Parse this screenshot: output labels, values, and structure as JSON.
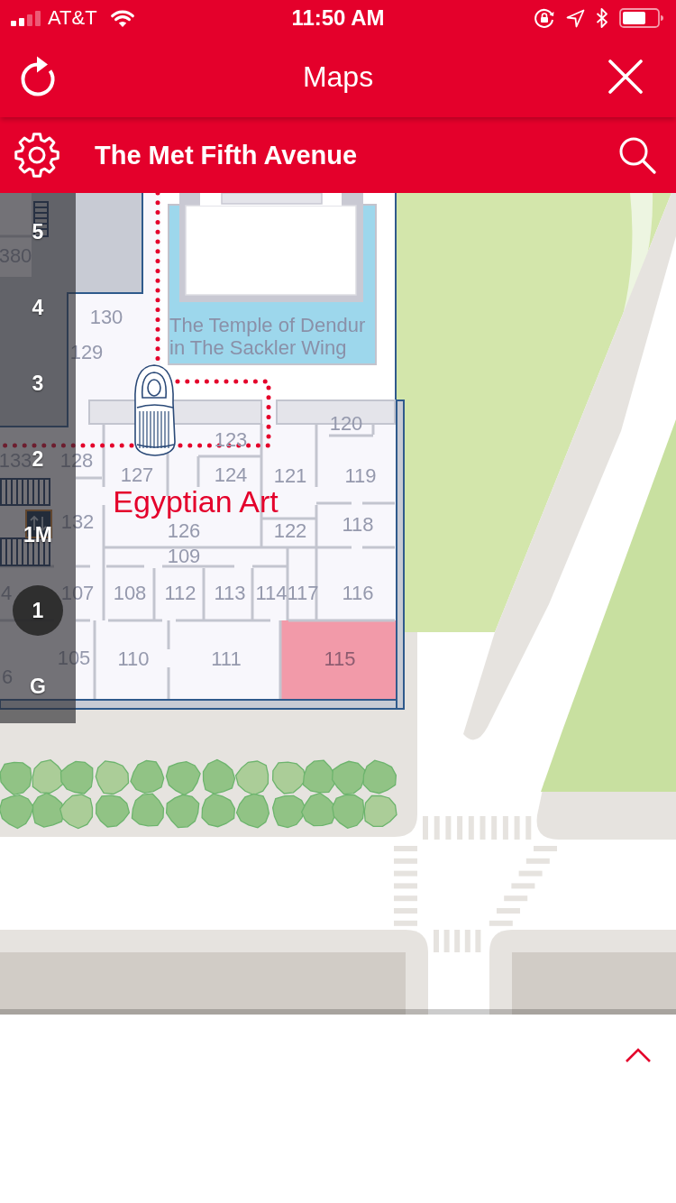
{
  "status_bar": {
    "carrier": "AT&T",
    "time": "11:50 AM"
  },
  "nav_bar": {
    "title": "Maps"
  },
  "location_bar": {
    "title": "The Met Fifth Avenue"
  },
  "map": {
    "landmark_label": "The Temple of Dendur in The Sackler Wing",
    "gallery_label": "Egyptian Art",
    "rooms": [
      {
        "number": "380",
        "highlighted": false
      },
      {
        "number": "130",
        "highlighted": false
      },
      {
        "number": "129",
        "highlighted": false
      },
      {
        "number": "120",
        "highlighted": false
      },
      {
        "number": "123",
        "highlighted": false
      },
      {
        "number": "133",
        "highlighted": false
      },
      {
        "number": "128",
        "highlighted": false
      },
      {
        "number": "127",
        "highlighted": false
      },
      {
        "number": "124",
        "highlighted": false
      },
      {
        "number": "121",
        "highlighted": false
      },
      {
        "number": "119",
        "highlighted": false
      },
      {
        "number": "132",
        "highlighted": false
      },
      {
        "number": "126",
        "highlighted": false
      },
      {
        "number": "122",
        "highlighted": false
      },
      {
        "number": "118",
        "highlighted": false
      },
      {
        "number": "109",
        "highlighted": false
      },
      {
        "number": "4",
        "highlighted": false
      },
      {
        "number": "107",
        "highlighted": false
      },
      {
        "number": "108",
        "highlighted": false
      },
      {
        "number": "112",
        "highlighted": false
      },
      {
        "number": "113",
        "highlighted": false
      },
      {
        "number": "114",
        "highlighted": false
      },
      {
        "number": "117",
        "highlighted": false
      },
      {
        "number": "116",
        "highlighted": false
      },
      {
        "number": "105",
        "highlighted": false
      },
      {
        "number": "110",
        "highlighted": false
      },
      {
        "number": "111",
        "highlighted": false
      },
      {
        "number": "115",
        "highlighted": true
      },
      {
        "number": "6",
        "highlighted": false
      }
    ],
    "floors": [
      {
        "label": "5",
        "selected": false
      },
      {
        "label": "4",
        "selected": false
      },
      {
        "label": "3",
        "selected": false
      },
      {
        "label": "2",
        "selected": false
      },
      {
        "label": "1M",
        "selected": false
      },
      {
        "label": "1",
        "selected": true
      },
      {
        "label": "G",
        "selected": false
      }
    ]
  }
}
